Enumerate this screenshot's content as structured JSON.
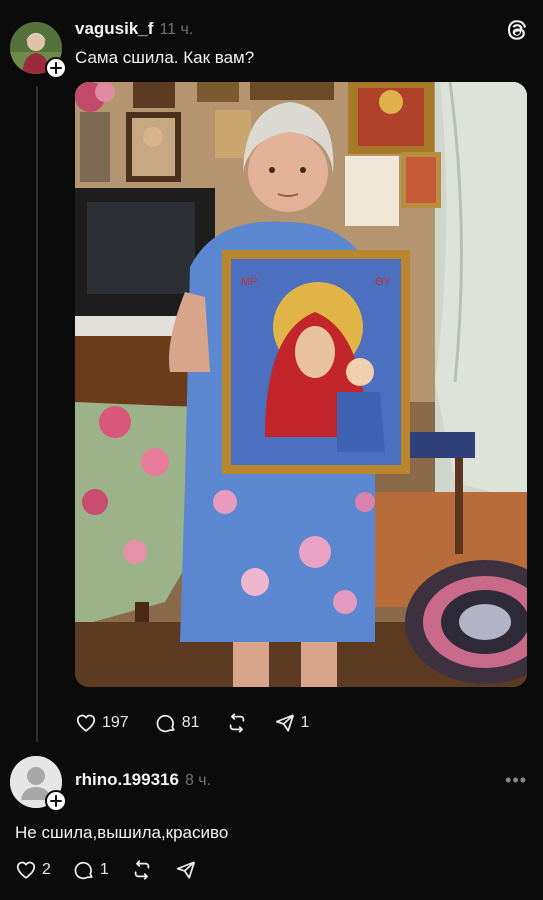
{
  "post": {
    "username": "vagusik_f",
    "time": "11 ч.",
    "caption": "Сама сшила. Как вам?",
    "likes": "197",
    "comments": "81",
    "shares": "1"
  },
  "reply": {
    "username": "rhino.199316",
    "time": "8 ч.",
    "text": "Не сшила,вышила,красиво",
    "likes": "2",
    "comments": "1",
    "more": "•••"
  },
  "icons": {
    "logo": "threads-logo-icon",
    "like": "heart-icon",
    "comment": "comment-bubble-icon",
    "repost": "repost-icon",
    "share": "share-arrow-icon",
    "follow": "plus-icon"
  },
  "colors": {
    "background": "#0b0b0b",
    "text": "#f2f2f2",
    "muted": "#6f6f6f"
  }
}
